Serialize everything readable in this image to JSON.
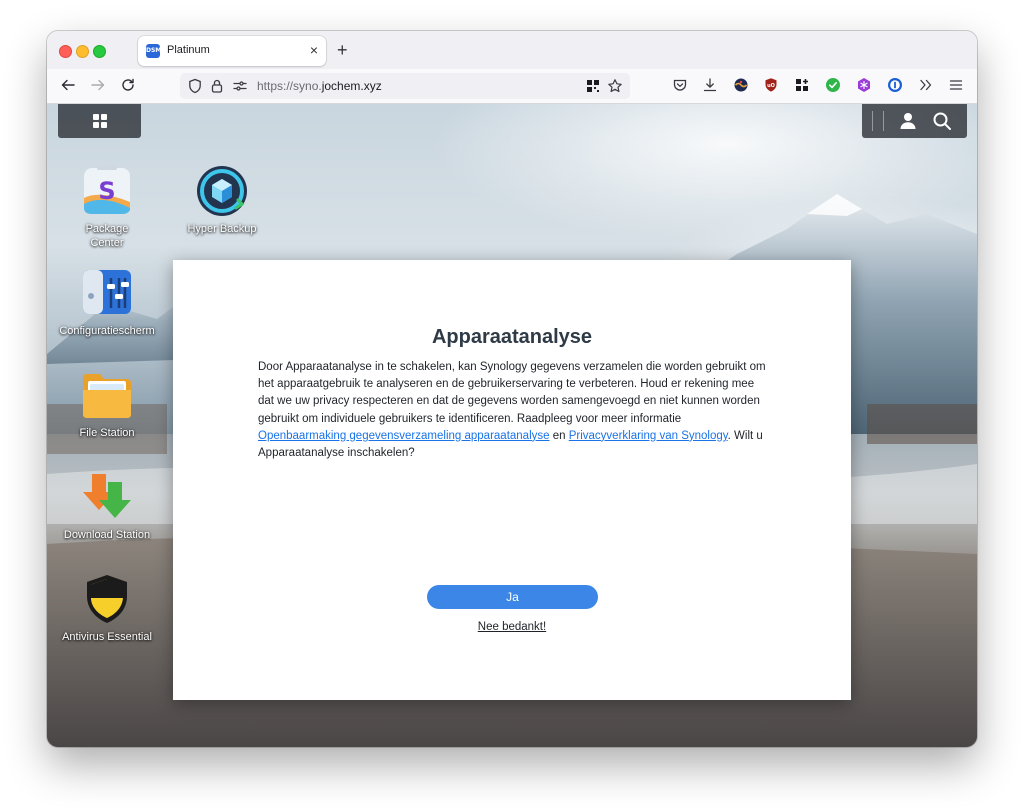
{
  "browser": {
    "tab_title": "Platinum",
    "tab_favicon_text": "DSM",
    "tab_close": "×",
    "new_tab": "+",
    "url_scheme": "https://syno.",
    "url_domain": "jochem.xyz"
  },
  "desktop": {
    "icons": [
      {
        "label": "Package\nCenter",
        "icon": "package-center-icon"
      },
      {
        "label": "Hyper Backup",
        "icon": "hyper-backup-icon"
      },
      {
        "label": "Configuratiescherm",
        "icon": "control-panel-icon"
      },
      {
        "label": "File Station",
        "icon": "file-station-icon"
      },
      {
        "label": "Download Station",
        "icon": "download-station-icon"
      },
      {
        "label": "Antivirus Essential",
        "icon": "antivirus-icon"
      }
    ]
  },
  "dialog": {
    "title": "Apparaatanalyse",
    "body_intro": "Door Apparaatanalyse in te schakelen, kan Synology gegevens verzamelen die worden gebruikt om het apparaatgebruik te analyseren en de gebruikerservaring te verbeteren. Houd er rekening mee dat we uw privacy respecteren en dat de gegevens worden samengevoegd en niet kunnen worden gebruikt om individuele gebruikers te identificeren. Raadpleeg voor meer informatie ",
    "link_disclosure": "Openbaarmaking gegevensverzameling apparaatanalyse",
    "body_and": " en ",
    "link_privacy": "Privacyverklaring van Synology",
    "body_question": ". Wilt u Apparaatanalyse inschakelen?",
    "yes_label": "Ja",
    "no_label": "Nee bedankt!"
  },
  "colors": {
    "accent": "#3b86e6",
    "link": "#1a73e8",
    "title": "#2e3a46"
  }
}
